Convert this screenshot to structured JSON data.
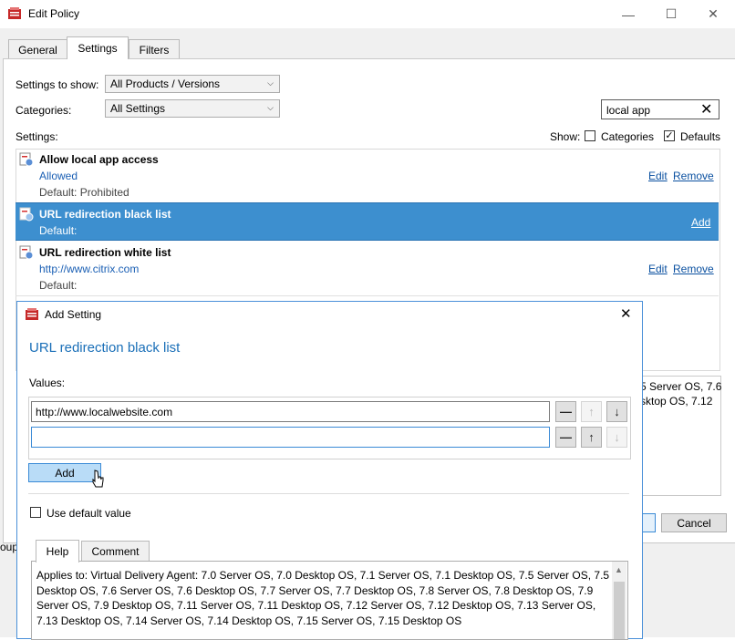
{
  "window": {
    "title": "Edit Policy",
    "controls": {
      "minimize": "—",
      "maximize": "☐",
      "close": "✕"
    }
  },
  "tabs": [
    {
      "label": "General",
      "active": false
    },
    {
      "label": "Settings",
      "active": true
    },
    {
      "label": "Filters",
      "active": false
    }
  ],
  "filters": {
    "settings_to_show_label": "Settings to show:",
    "settings_to_show_value": "All Products / Versions",
    "categories_label": "Categories:",
    "categories_value": "All Settings",
    "search_value": "local app",
    "settings_label": "Settings:",
    "show_label": "Show:",
    "show_categories": "Categories",
    "show_defaults": "Defaults"
  },
  "settings_list": [
    {
      "name": "Allow local app access",
      "value": "Allowed",
      "default": "Default: Prohibited",
      "actions": [
        "Edit",
        "Remove"
      ]
    },
    {
      "name": "URL redirection black list",
      "value": "",
      "default": "Default:",
      "actions": [
        "Add"
      ],
      "selected": true
    },
    {
      "name": "URL redirection white list",
      "value": "http://www.citrix.com",
      "default": "Default:",
      "actions": [
        "Edit",
        "Remove"
      ]
    }
  ],
  "background_text": {
    "line1": "5 Server OS, 7.6",
    "line2": "sktop OS, 7.12",
    "left_clip": "oup"
  },
  "main_buttons": {
    "cancel": "Cancel"
  },
  "dialog": {
    "title": "Add Setting",
    "heading": "URL redirection black list",
    "values_label": "Values:",
    "values": [
      "http://www.localwebsite.com",
      ""
    ],
    "add_button": "Add",
    "use_default_label": "Use default value",
    "help_tabs": [
      "Help",
      "Comment"
    ],
    "help_text": "Applies to: Virtual Delivery Agent: 7.0 Server OS, 7.0 Desktop OS, 7.1 Server OS, 7.1 Desktop OS, 7.5 Server OS, 7.5 Desktop OS, 7.6 Server OS, 7.6 Desktop OS, 7.7 Server OS, 7.7 Desktop OS, 7.8 Server OS, 7.8 Desktop OS, 7.9 Server OS, 7.9 Desktop OS, 7.11 Server OS, 7.11 Desktop OS, 7.12 Server OS, 7.12 Desktop OS, 7.13 Server OS, 7.13 Desktop OS, 7.14 Server OS, 7.14 Desktop OS, 7.15 Server OS, 7.15 Desktop OS",
    "close": "✕"
  },
  "colors": {
    "selection": "#3d8fcf",
    "link": "#0a50a0",
    "heading": "#1a6fb8",
    "add_button": "#b9dcf7"
  }
}
